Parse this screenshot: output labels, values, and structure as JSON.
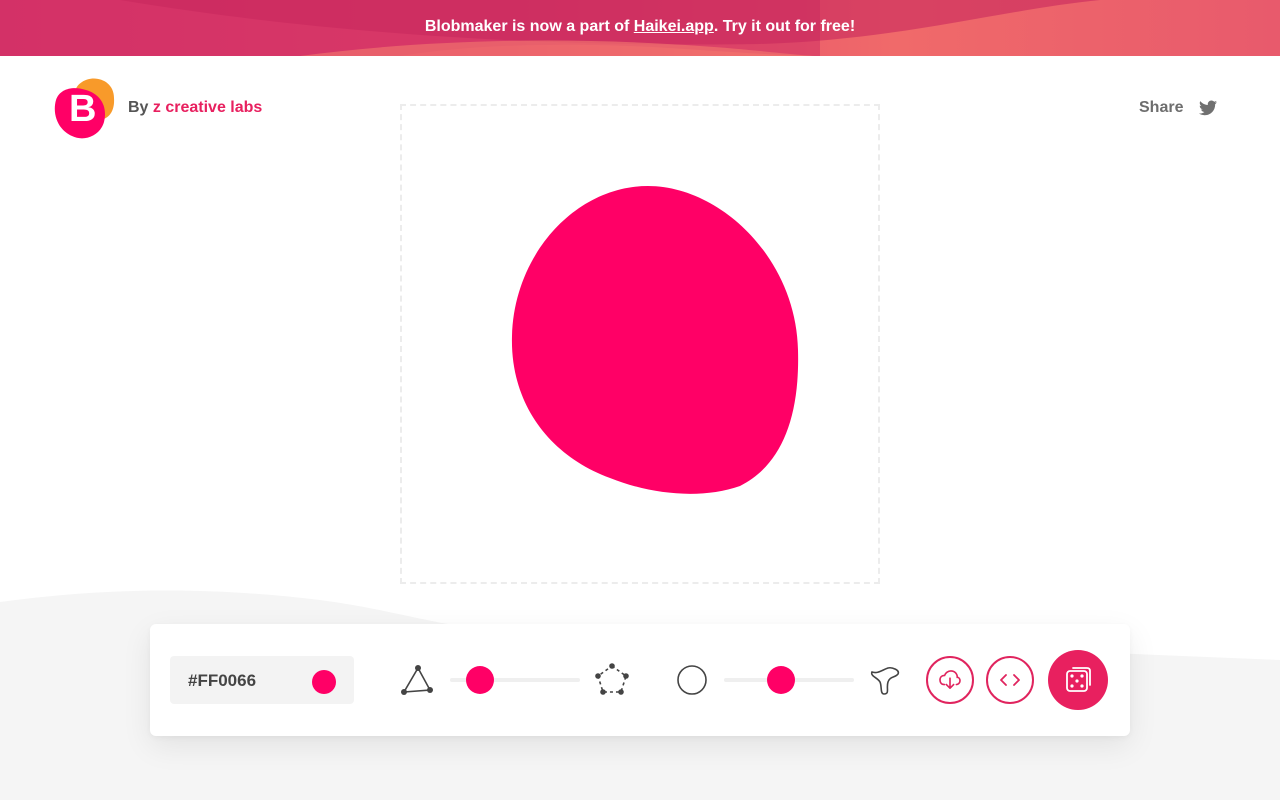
{
  "banner": {
    "prefix": "Blobmaker is now a part of ",
    "link": "Haikei.app",
    "suffix": ". Try it out for free!"
  },
  "header": {
    "logo_letter": "B",
    "by": "By ",
    "by_link": "z creative labs",
    "share": "Share",
    "share_icon": "twitter-icon"
  },
  "blob": {
    "fill": "#FF0066"
  },
  "controls": {
    "color_value": "#FF0066",
    "complexity_slider": {
      "min_icon": "triangle-nodes-icon",
      "max_icon": "pentagon-nodes-icon",
      "value": 0.2
    },
    "contrast_slider": {
      "min_icon": "circle-icon",
      "max_icon": "spiky-blob-icon",
      "value": 0.45
    },
    "buttons": [
      "download-icon",
      "code-icon",
      "dice-icon"
    ]
  },
  "colors": {
    "accent": "#E8205F",
    "blob": "#FF0066"
  }
}
